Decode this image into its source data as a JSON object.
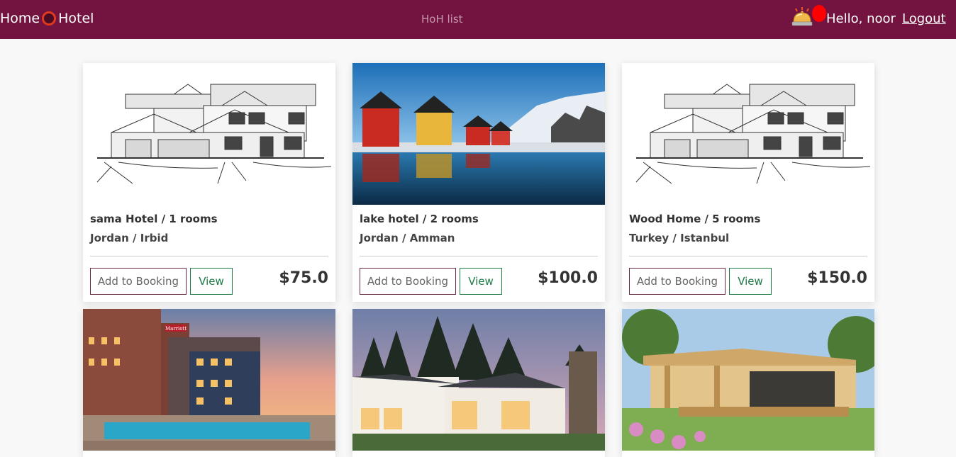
{
  "nav": {
    "brand_left": "Home",
    "brand_right": "Hotel",
    "center_link": "HoH list",
    "greeting": "Hello, noor",
    "logout": "Logout",
    "icons": [
      "hotel-bell-icon",
      "notification-dot"
    ],
    "colors": {
      "navbar": "#72143f",
      "notif": "#ff0000"
    }
  },
  "cards": [
    {
      "title": "sama Hotel / 1 rooms",
      "location": "Jordan / Irbid",
      "book_label": "Add to Booking",
      "view_label": "View",
      "price": "$75.0"
    },
    {
      "title": "lake hotel / 2 rooms",
      "location": "Jordan / Amman",
      "book_label": "Add to Booking",
      "view_label": "View",
      "price": "$100.0"
    },
    {
      "title": "Wood Home / 5 rooms",
      "location": "Turkey / Istanbul",
      "book_label": "Add to Booking",
      "view_label": "View",
      "price": "$150.0"
    }
  ],
  "second_row": {
    "sign_text": "Marriott"
  }
}
